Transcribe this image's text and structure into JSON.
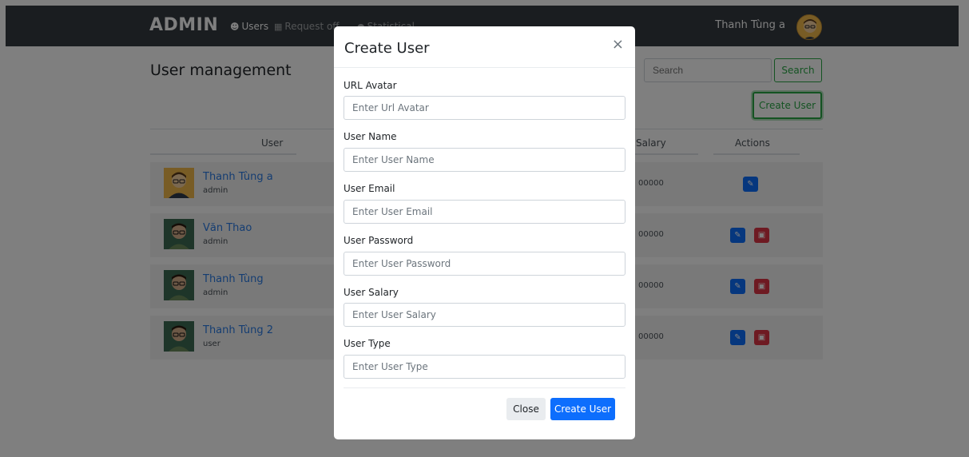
{
  "navbar": {
    "brand": "ADMIN",
    "items": [
      {
        "label": "Users",
        "icon": "user-icon"
      },
      {
        "label": "Request off",
        "icon": "calendar-icon"
      },
      {
        "label": "Statistical",
        "icon": "chart-icon"
      }
    ],
    "username": "Thanh Tùng a"
  },
  "main": {
    "title": "User management",
    "search": {
      "placeholder": "Search",
      "button": "Search"
    },
    "create_button": "Create User",
    "table": {
      "headers": [
        "User",
        "Salary",
        "Actions"
      ],
      "rows": [
        {
          "name": "Thanh Tùng a",
          "role": "admin",
          "salary": "00000"
        },
        {
          "name": "Văn Thao",
          "role": "admin",
          "salary": "00000"
        },
        {
          "name": "Thanh Tùng",
          "role": "admin",
          "salary": "00000"
        },
        {
          "name": "Thanh Tùng 2",
          "role": "user",
          "salary": "00000"
        }
      ]
    }
  },
  "modal": {
    "title": "Create User",
    "close_icon": "×",
    "fields": [
      {
        "label": "URL Avatar",
        "placeholder": "Enter Url Avatar"
      },
      {
        "label": "User Name",
        "placeholder": "Enter User Name"
      },
      {
        "label": "User Email",
        "placeholder": "Enter User Email"
      },
      {
        "label": "User Password",
        "placeholder": "Enter User Password"
      },
      {
        "label": "User Salary",
        "placeholder": "Enter User Salary"
      },
      {
        "label": "User Type",
        "placeholder": "Enter User Type"
      }
    ],
    "close_button": "Close",
    "create_button": "Create User"
  },
  "colors": {
    "navbar": "#343a40",
    "primary": "#0d6efd",
    "success": "#28a745",
    "danger": "#dc3545",
    "link": "#2a7be4"
  }
}
